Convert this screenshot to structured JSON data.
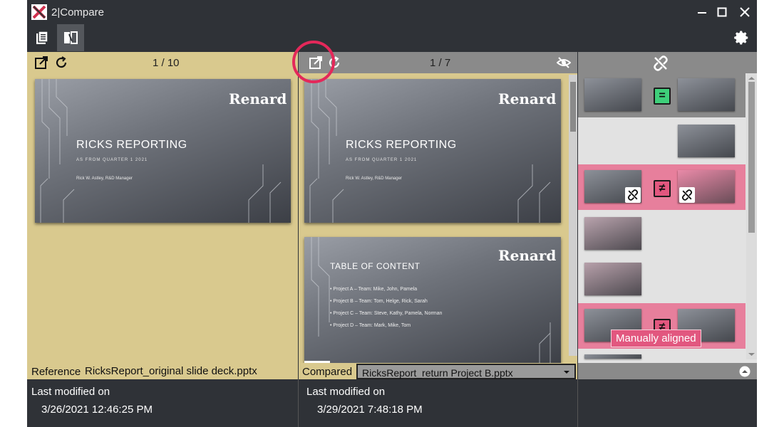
{
  "window": {
    "title": "2|Compare"
  },
  "left": {
    "page_count": "1 / 10",
    "slide": {
      "title": "RICKS REPORTING",
      "subtitle": "AS FROM QUARTER 1 2021",
      "author": "Rick W. Astley, R&D Manager",
      "logo": "Renard"
    },
    "footer": {
      "label": "Reference",
      "file": "RicksReport_original slide deck.pptx"
    },
    "info": {
      "title": "Last modified on",
      "value": "3/26/2021 12:46:25 PM"
    }
  },
  "middle": {
    "page_count": "1 / 7",
    "slide1": {
      "title": "RICKS REPORTING",
      "subtitle": "AS FROM QUARTER 1 2021",
      "author": "Rick W. Astley, R&D Manager",
      "logo": "Renard"
    },
    "slide2": {
      "title": "TABLE OF CONTENT",
      "logo": "Renard",
      "items": [
        "• Project A – Team: Mike, John, Pamela",
        "• Project B – Team: Tom, Helge, Rick, Sarah",
        "• Project C – Team: Steve, Kathy, Pamela, Norman",
        "• Project D – Team: Mark, Mike, Tom"
      ]
    },
    "footer": {
      "label": "Compared",
      "file": "RicksReport_return Project B.pptx"
    },
    "info": {
      "title": "Last modified on",
      "value": "3/29/2021 7:48:18 PM"
    }
  },
  "right": {
    "badges": {
      "equal": "=",
      "not_equal": "≠"
    },
    "tooltip": "Manually aligned"
  },
  "colors": {
    "accent_pink": "#e2577f",
    "highlight_ring": "#e4285a",
    "reference_bg": "#d9c98e",
    "equal_green": "#3ecf7a"
  }
}
